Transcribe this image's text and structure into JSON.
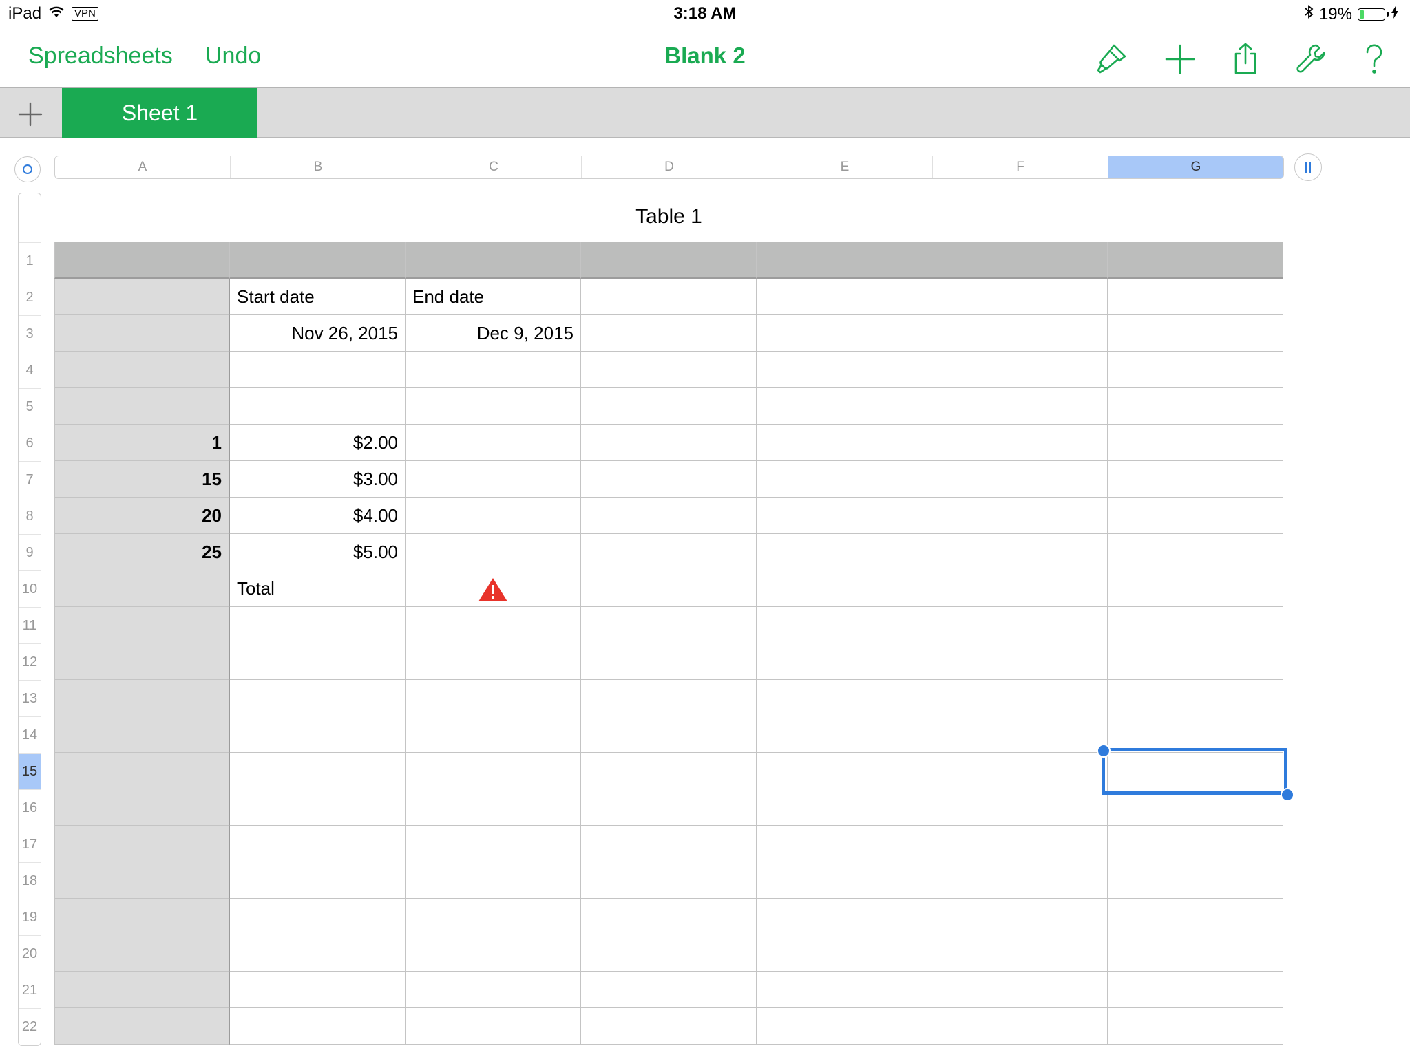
{
  "status": {
    "device": "iPad",
    "vpn": "VPN",
    "time": "3:18 AM",
    "battery_percent": "19%",
    "battery_level": 0.19
  },
  "nav": {
    "spreadsheets_label": "Spreadsheets",
    "undo_label": "Undo",
    "title": "Blank 2",
    "tool_icons": [
      "paintbrush-icon",
      "plus-icon",
      "share-icon",
      "wrench-icon",
      "help-icon"
    ]
  },
  "tabs": {
    "add_icon": "plus-icon",
    "sheets": [
      "Sheet 1"
    ]
  },
  "columns": [
    "A",
    "B",
    "C",
    "D",
    "E",
    "F",
    "G"
  ],
  "selected_column": "G",
  "rows": [
    "1",
    "2",
    "3",
    "4",
    "5",
    "6",
    "7",
    "8",
    "9",
    "10",
    "11",
    "12",
    "13",
    "14",
    "15",
    "16",
    "17",
    "18",
    "19",
    "20",
    "21",
    "22"
  ],
  "selected_row": "15",
  "table": {
    "title": "Table 1",
    "cells": {
      "B2": "Start date",
      "C2": "End date",
      "B3": "Nov 26, 2015",
      "C3": "Dec 9, 2015",
      "A6": "1",
      "B6": "$2.00",
      "A7": "15",
      "B7": "$3.00",
      "A8": "20",
      "B8": "$4.00",
      "A9": "25",
      "B9": "$5.00",
      "B10": "Total"
    },
    "warning_cell": "C10"
  },
  "colors": {
    "accent": "#1aaa52",
    "selection": "#2f7bdc",
    "header_row": "#bcbdbc",
    "header_col": "#dcdcdc",
    "warning": "#e8332a"
  }
}
